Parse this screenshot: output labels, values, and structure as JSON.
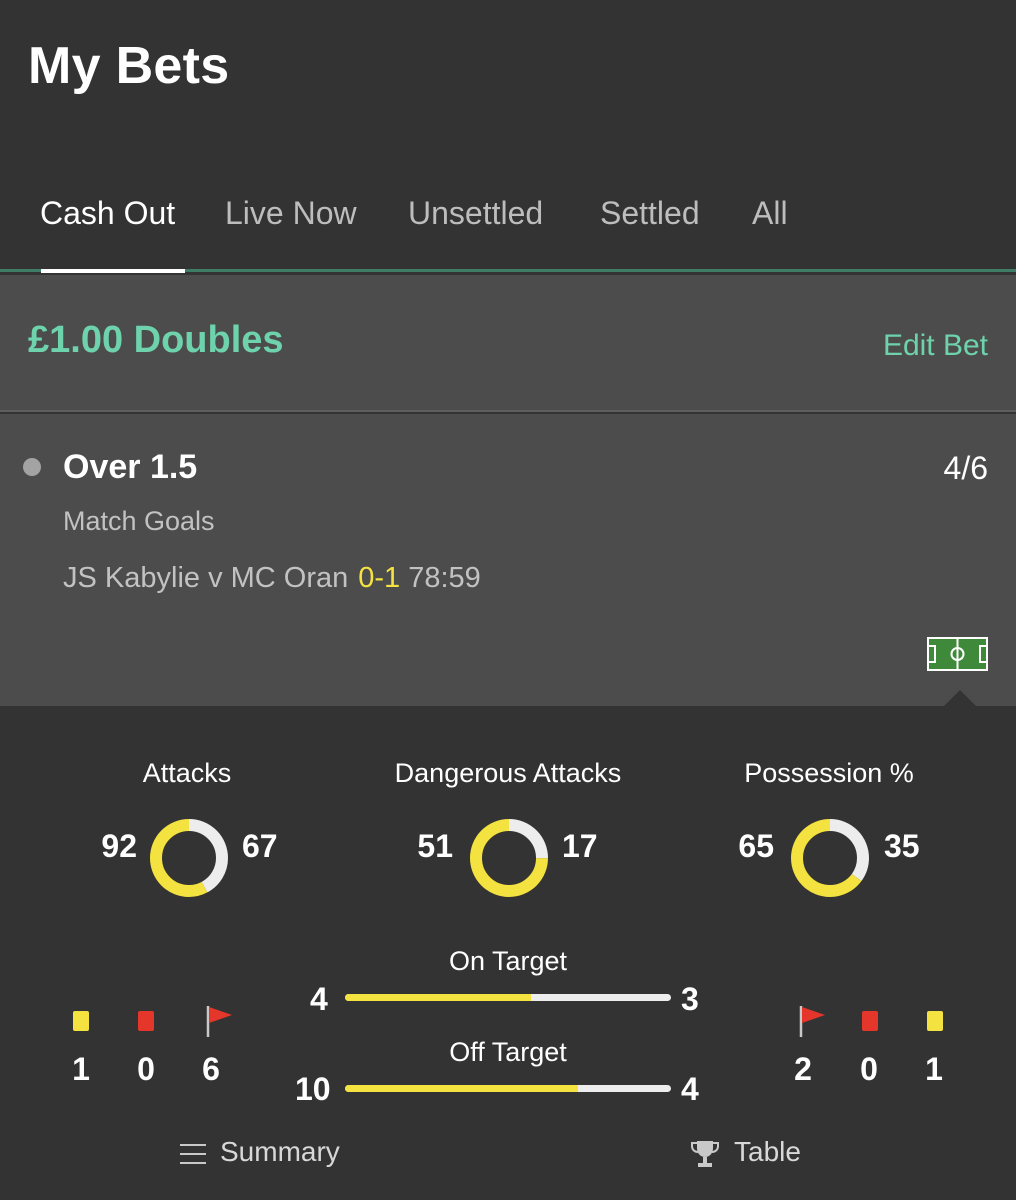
{
  "page": {
    "title": "My Bets"
  },
  "tabs": [
    {
      "label": "Cash Out",
      "active": true
    },
    {
      "label": "Live Now",
      "active": false
    },
    {
      "label": "Unsettled",
      "active": false
    },
    {
      "label": "Settled",
      "active": false
    },
    {
      "label": "All",
      "active": false
    }
  ],
  "bet": {
    "title": "£1.00 Doubles",
    "edit_label": "Edit Bet"
  },
  "selection": {
    "name": "Over 1.5",
    "odds": "4/6",
    "market": "Match Goals",
    "event": "JS Kabylie v MC Oran",
    "score": "0-1",
    "clock": "78:59",
    "pitch_icon": "football-pitch-icon"
  },
  "stats": {
    "donuts": [
      {
        "label": "Attacks",
        "home": "92",
        "away": "67",
        "home_value": 92,
        "away_value": 67
      },
      {
        "label": "Dangerous Attacks",
        "home": "51",
        "away": "17",
        "home_value": 51,
        "away_value": 17
      },
      {
        "label": "Possession %",
        "home": "65",
        "away": "35",
        "home_value": 65,
        "away_value": 35
      }
    ],
    "bars": [
      {
        "label": "On Target",
        "home": "4",
        "away": "3",
        "home_value": 4,
        "away_value": 3
      },
      {
        "label": "Off Target",
        "home": "10",
        "away": "4",
        "home_value": 10,
        "away_value": 4
      }
    ],
    "home_cards": {
      "yellow": "1",
      "red": "0",
      "corners": "6"
    },
    "away_cards": {
      "corners": "2",
      "red": "0",
      "yellow": "1"
    },
    "colors": {
      "home": "#f3e23f",
      "away": "#ededed",
      "red_card": "#e5362b",
      "accent": "#6ed3ac"
    }
  },
  "footer": {
    "summary_label": "Summary",
    "summary_icon": "list-icon",
    "table_label": "Table",
    "table_icon": "trophy-icon"
  }
}
